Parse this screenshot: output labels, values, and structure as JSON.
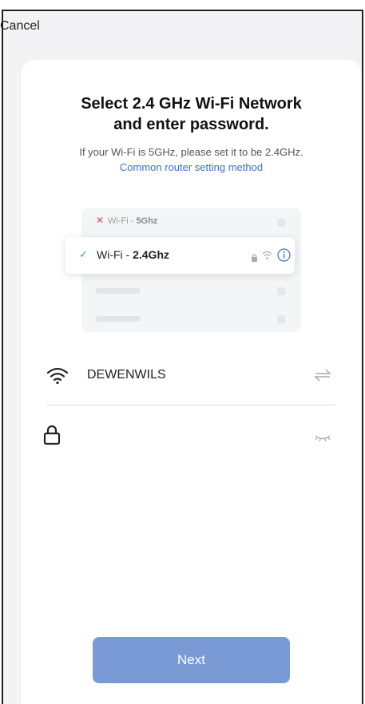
{
  "header": {
    "cancel_label": "Cancel"
  },
  "title": {
    "line1": "Select 2.4 GHz Wi-Fi Network",
    "line2": "and enter password."
  },
  "hint": "If your Wi-Fi is 5GHz, please set it to be 2.4GHz.",
  "link": "Common router setting method",
  "illustration": {
    "bad_network": {
      "prefix": "Wi-Fi - ",
      "band": "5Ghz",
      "mark": "✕"
    },
    "good_network": {
      "prefix": "Wi-Fi - ",
      "band": "2.4Ghz",
      "mark": "✓"
    }
  },
  "network": {
    "ssid": "DEWENWILS",
    "icon": "wifi-icon",
    "switch_icon": "switch-arrows-icon"
  },
  "password": {
    "value": "",
    "placeholder": "",
    "icon": "lock-icon",
    "toggle_icon": "eye-closed-icon"
  },
  "next_label": "Next",
  "colors": {
    "accent": "#3d6fd6",
    "button": "#7a9ad6",
    "success": "#27b06a",
    "error": "#e04848"
  }
}
